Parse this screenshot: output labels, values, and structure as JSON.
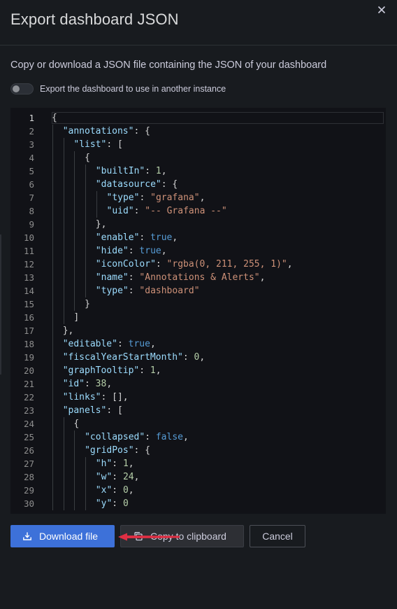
{
  "modal": {
    "title": "Export dashboard JSON",
    "close_icon": "close-icon",
    "description": "Copy or download a JSON file containing the JSON of your dashboard",
    "toggle": {
      "label": "Export the dashboard to use in another instance",
      "enabled": false
    }
  },
  "editor": {
    "active_line": 1,
    "line_numbers": [
      "1",
      "2",
      "3",
      "4",
      "5",
      "6",
      "7",
      "8",
      "9",
      "10",
      "11",
      "12",
      "13",
      "14",
      "15",
      "16",
      "17",
      "18",
      "19",
      "20",
      "21",
      "22",
      "23",
      "24",
      "25",
      "26",
      "27",
      "28",
      "29",
      "30"
    ],
    "lines": [
      {
        "indent": 0,
        "tokens": [
          {
            "t": "p",
            "v": "{"
          }
        ]
      },
      {
        "indent": 1,
        "tokens": [
          {
            "t": "k",
            "v": "\"annotations\""
          },
          {
            "t": "p",
            "v": ": {"
          }
        ]
      },
      {
        "indent": 2,
        "tokens": [
          {
            "t": "k",
            "v": "\"list\""
          },
          {
            "t": "p",
            "v": ": ["
          }
        ]
      },
      {
        "indent": 3,
        "tokens": [
          {
            "t": "p",
            "v": "{"
          }
        ]
      },
      {
        "indent": 4,
        "tokens": [
          {
            "t": "k",
            "v": "\"builtIn\""
          },
          {
            "t": "p",
            "v": ": "
          },
          {
            "t": "n",
            "v": "1"
          },
          {
            "t": "p",
            "v": ","
          }
        ]
      },
      {
        "indent": 4,
        "tokens": [
          {
            "t": "k",
            "v": "\"datasource\""
          },
          {
            "t": "p",
            "v": ": {"
          }
        ]
      },
      {
        "indent": 5,
        "tokens": [
          {
            "t": "k",
            "v": "\"type\""
          },
          {
            "t": "p",
            "v": ": "
          },
          {
            "t": "s",
            "v": "\"grafana\""
          },
          {
            "t": "p",
            "v": ","
          }
        ]
      },
      {
        "indent": 5,
        "tokens": [
          {
            "t": "k",
            "v": "\"uid\""
          },
          {
            "t": "p",
            "v": ": "
          },
          {
            "t": "s",
            "v": "\"-- Grafana --\""
          }
        ]
      },
      {
        "indent": 4,
        "tokens": [
          {
            "t": "p",
            "v": "},"
          }
        ]
      },
      {
        "indent": 4,
        "tokens": [
          {
            "t": "k",
            "v": "\"enable\""
          },
          {
            "t": "p",
            "v": ": "
          },
          {
            "t": "b",
            "v": "true"
          },
          {
            "t": "p",
            "v": ","
          }
        ]
      },
      {
        "indent": 4,
        "tokens": [
          {
            "t": "k",
            "v": "\"hide\""
          },
          {
            "t": "p",
            "v": ": "
          },
          {
            "t": "b",
            "v": "true"
          },
          {
            "t": "p",
            "v": ","
          }
        ]
      },
      {
        "indent": 4,
        "tokens": [
          {
            "t": "k",
            "v": "\"iconColor\""
          },
          {
            "t": "p",
            "v": ": "
          },
          {
            "t": "s",
            "v": "\"rgba(0, 211, 255, 1)\""
          },
          {
            "t": "p",
            "v": ","
          }
        ]
      },
      {
        "indent": 4,
        "tokens": [
          {
            "t": "k",
            "v": "\"name\""
          },
          {
            "t": "p",
            "v": ": "
          },
          {
            "t": "s",
            "v": "\"Annotations & Alerts\""
          },
          {
            "t": "p",
            "v": ","
          }
        ]
      },
      {
        "indent": 4,
        "tokens": [
          {
            "t": "k",
            "v": "\"type\""
          },
          {
            "t": "p",
            "v": ": "
          },
          {
            "t": "s",
            "v": "\"dashboard\""
          }
        ]
      },
      {
        "indent": 3,
        "tokens": [
          {
            "t": "p",
            "v": "}"
          }
        ]
      },
      {
        "indent": 2,
        "tokens": [
          {
            "t": "p",
            "v": "]"
          }
        ]
      },
      {
        "indent": 1,
        "tokens": [
          {
            "t": "p",
            "v": "},"
          }
        ]
      },
      {
        "indent": 1,
        "tokens": [
          {
            "t": "k",
            "v": "\"editable\""
          },
          {
            "t": "p",
            "v": ": "
          },
          {
            "t": "b",
            "v": "true"
          },
          {
            "t": "p",
            "v": ","
          }
        ]
      },
      {
        "indent": 1,
        "tokens": [
          {
            "t": "k",
            "v": "\"fiscalYearStartMonth\""
          },
          {
            "t": "p",
            "v": ": "
          },
          {
            "t": "n",
            "v": "0"
          },
          {
            "t": "p",
            "v": ","
          }
        ]
      },
      {
        "indent": 1,
        "tokens": [
          {
            "t": "k",
            "v": "\"graphTooltip\""
          },
          {
            "t": "p",
            "v": ": "
          },
          {
            "t": "n",
            "v": "1"
          },
          {
            "t": "p",
            "v": ","
          }
        ]
      },
      {
        "indent": 1,
        "tokens": [
          {
            "t": "k",
            "v": "\"id\""
          },
          {
            "t": "p",
            "v": ": "
          },
          {
            "t": "n",
            "v": "38"
          },
          {
            "t": "p",
            "v": ","
          }
        ]
      },
      {
        "indent": 1,
        "tokens": [
          {
            "t": "k",
            "v": "\"links\""
          },
          {
            "t": "p",
            "v": ": [],"
          }
        ]
      },
      {
        "indent": 1,
        "tokens": [
          {
            "t": "k",
            "v": "\"panels\""
          },
          {
            "t": "p",
            "v": ": ["
          }
        ]
      },
      {
        "indent": 2,
        "tokens": [
          {
            "t": "p",
            "v": "{"
          }
        ]
      },
      {
        "indent": 3,
        "tokens": [
          {
            "t": "k",
            "v": "\"collapsed\""
          },
          {
            "t": "p",
            "v": ": "
          },
          {
            "t": "b",
            "v": "false"
          },
          {
            "t": "p",
            "v": ","
          }
        ]
      },
      {
        "indent": 3,
        "tokens": [
          {
            "t": "k",
            "v": "\"gridPos\""
          },
          {
            "t": "p",
            "v": ": {"
          }
        ]
      },
      {
        "indent": 4,
        "tokens": [
          {
            "t": "k",
            "v": "\"h\""
          },
          {
            "t": "p",
            "v": ": "
          },
          {
            "t": "n",
            "v": "1"
          },
          {
            "t": "p",
            "v": ","
          }
        ]
      },
      {
        "indent": 4,
        "tokens": [
          {
            "t": "k",
            "v": "\"w\""
          },
          {
            "t": "p",
            "v": ": "
          },
          {
            "t": "n",
            "v": "24"
          },
          {
            "t": "p",
            "v": ","
          }
        ]
      },
      {
        "indent": 4,
        "tokens": [
          {
            "t": "k",
            "v": "\"x\""
          },
          {
            "t": "p",
            "v": ": "
          },
          {
            "t": "n",
            "v": "0"
          },
          {
            "t": "p",
            "v": ","
          }
        ]
      },
      {
        "indent": 4,
        "tokens": [
          {
            "t": "k",
            "v": "\"y\""
          },
          {
            "t": "p",
            "v": ": "
          },
          {
            "t": "n",
            "v": "0"
          }
        ]
      }
    ]
  },
  "footer": {
    "download_label": "Download file",
    "download_icon": "download-icon",
    "copy_label": "Copy to clipboard",
    "copy_icon": "copy-icon",
    "cancel_label": "Cancel",
    "annotation_arrow_color": "#e02f44"
  },
  "colors": {
    "background": "#181b1f",
    "editor_bg": "#111217",
    "primary": "#3d71d9"
  }
}
